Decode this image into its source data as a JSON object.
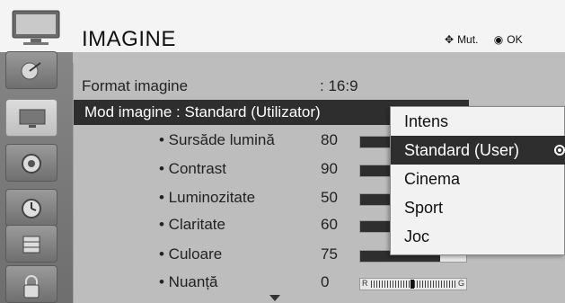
{
  "header": {
    "title": "IMAGINE",
    "hint_move": "Mut.",
    "hint_ok": "OK"
  },
  "menu": {
    "format_label": "Format imagine",
    "format_value": ": 16:9",
    "mode_label": "Mod imagine : Standard (Utilizator)",
    "settings": [
      {
        "label": "• Sursăde lumină",
        "value": "80",
        "level": 80
      },
      {
        "label": "• Contrast",
        "value": "90",
        "level": 90
      },
      {
        "label": "• Luminozitate",
        "value": "50",
        "level": 50
      },
      {
        "label": "• Claritate",
        "value": "60",
        "level": 60
      },
      {
        "label": "• Culoare",
        "value": "75",
        "level": 75
      },
      {
        "label": "• Nuanță",
        "value": "0",
        "level": 0
      }
    ],
    "tint_left": "R",
    "tint_right": "G"
  },
  "popup": {
    "options": [
      "Intens",
      "Standard (User)",
      "Cinema",
      "Sport",
      "Joc"
    ],
    "selected": "Standard (User)"
  },
  "sidebar": {
    "icons": [
      "tv-icon",
      "satellite-dish-icon",
      "monitor-icon",
      "speaker-icon",
      "clock-icon",
      "calendar-icon",
      "lock-icon"
    ]
  },
  "colors": {
    "selection": "#2e2e2e",
    "background": "#bdbdbd",
    "header": "#f4f4f4"
  }
}
